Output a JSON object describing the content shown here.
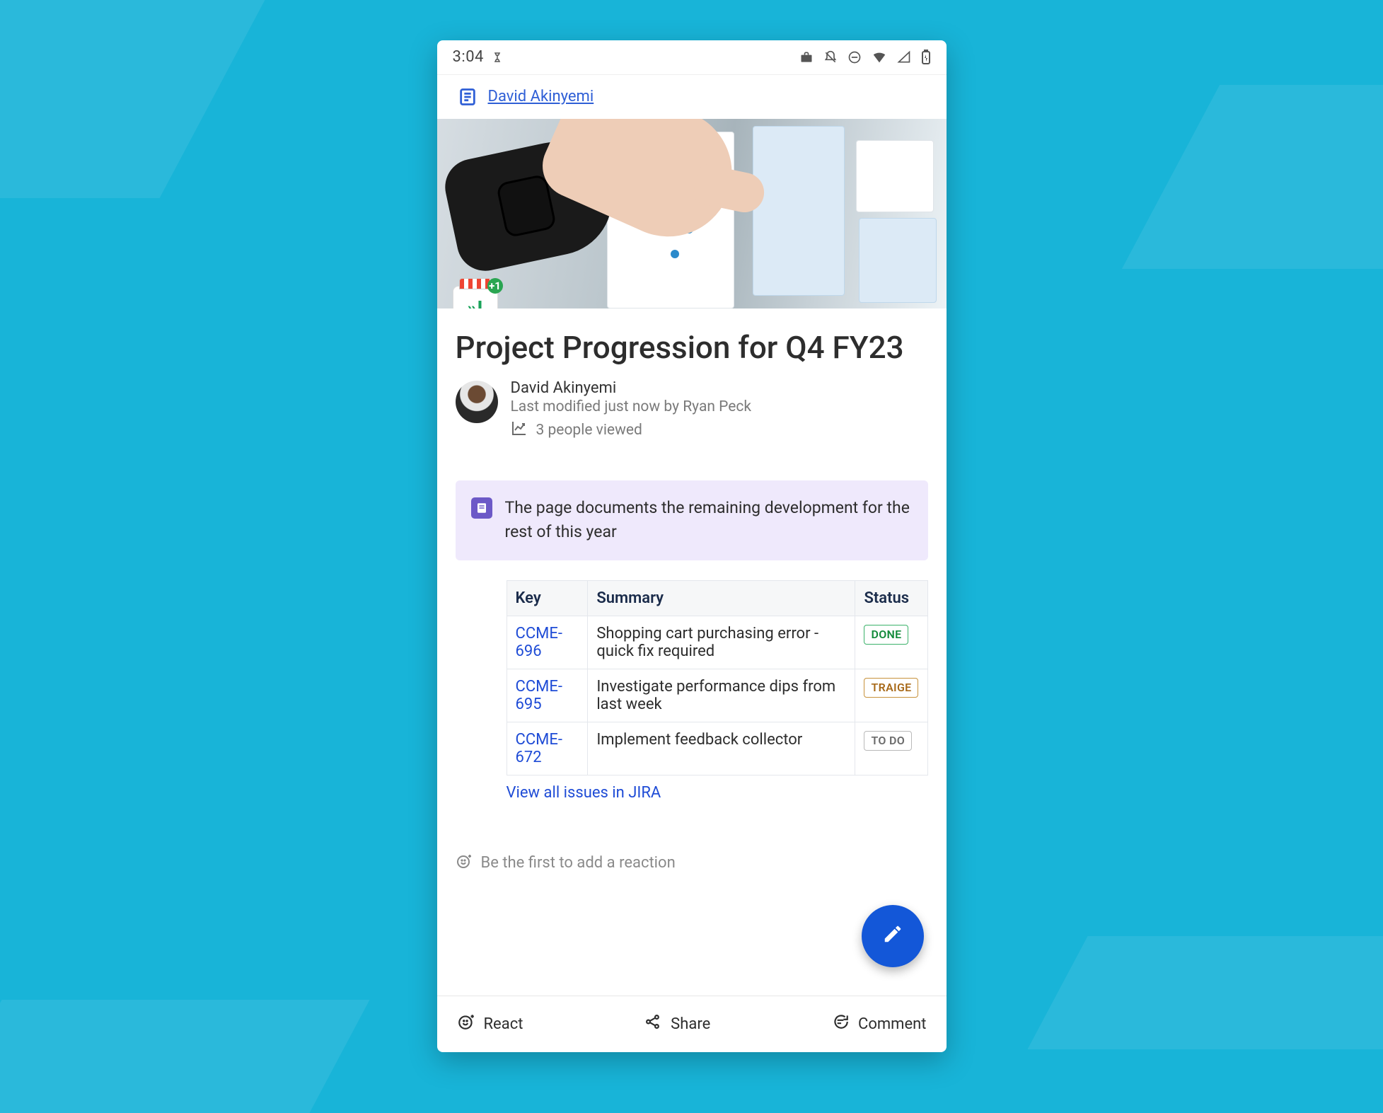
{
  "status_bar": {
    "time": "3:04"
  },
  "breadcrumb": {
    "author_link": "David Akinyemi"
  },
  "page": {
    "title": "Project Progression for Q4 FY23",
    "author": "David Akinyemi",
    "modified": "Last modified just now by Ryan Peck",
    "viewed": "3 people viewed"
  },
  "panel": {
    "text": "The page documents the remaining development for the rest of this year"
  },
  "jira": {
    "headers": {
      "key": "Key",
      "summary": "Summary",
      "status": "Status"
    },
    "rows": [
      {
        "key": "CCME-696",
        "summary": "Shopping cart purchasing error - quick fix required",
        "status": "DONE",
        "status_class": "status-done"
      },
      {
        "key": "CCME-695",
        "summary": "Investigate performance dips from last week",
        "status": "TRAIGE",
        "status_class": "status-traige"
      },
      {
        "key": "CCME-672",
        "summary": "Implement feedback collector",
        "status": "TO DO",
        "status_class": "status-todo"
      }
    ],
    "view_all": "View all issues in JIRA"
  },
  "reactions": {
    "prompt": "Be the first to add a reaction"
  },
  "bottom_bar": {
    "react": "React",
    "share": "Share",
    "comment": "Comment"
  }
}
